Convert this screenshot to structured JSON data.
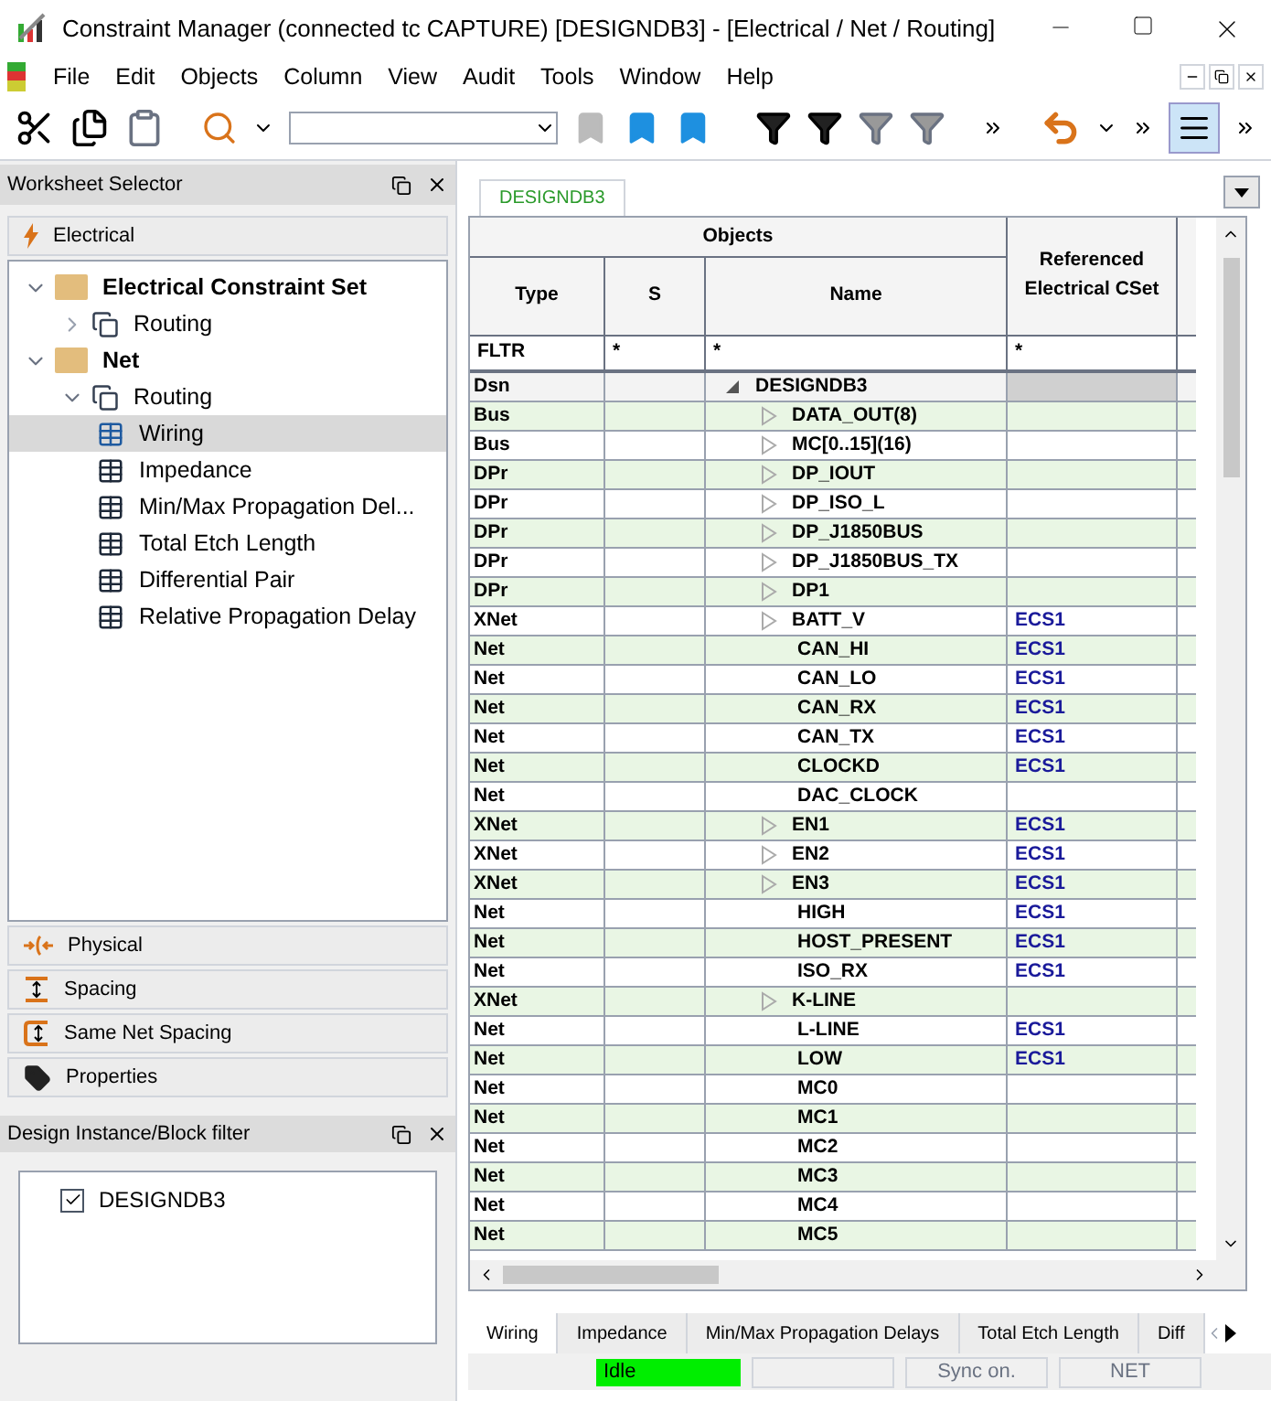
{
  "window": {
    "title": "Constraint Manager (connected tc CAPTURE) [DESIGNDB3] - [Electrical / Net / Routing]"
  },
  "menu": [
    "File",
    "Edit",
    "Objects",
    "Column",
    "View",
    "Audit",
    "Tools",
    "Window",
    "Help"
  ],
  "worksheet_selector": {
    "title": "Worksheet Selector",
    "domain": "Electrical",
    "tree": [
      {
        "label": "Electrical Constraint Set",
        "kind": "folder",
        "expanded": true,
        "children": [
          {
            "label": "Routing",
            "kind": "group",
            "expanded": false
          }
        ]
      },
      {
        "label": "Net",
        "kind": "folder",
        "expanded": true,
        "children": [
          {
            "label": "Routing",
            "kind": "group",
            "expanded": true,
            "children": [
              {
                "label": "Wiring",
                "kind": "sheet",
                "selected": true
              },
              {
                "label": "Impedance",
                "kind": "sheet",
                "selected": false
              },
              {
                "label": "Min/Max Propagation Del...",
                "kind": "sheet",
                "selected": false
              },
              {
                "label": "Total Etch Length",
                "kind": "sheet",
                "selected": false
              },
              {
                "label": "Differential Pair",
                "kind": "sheet",
                "selected": false
              },
              {
                "label": "Relative Propagation Delay",
                "kind": "sheet",
                "selected": false
              }
            ]
          }
        ]
      }
    ],
    "domains": [
      {
        "label": "Physical",
        "kind": "physical"
      },
      {
        "label": "Spacing",
        "kind": "spacing"
      },
      {
        "label": "Same Net Spacing",
        "kind": "samenet"
      },
      {
        "label": "Properties",
        "kind": "properties"
      }
    ]
  },
  "block_filter": {
    "title": "Design Instance/Block filter",
    "items": [
      {
        "label": "DESIGNDB3",
        "checked": true
      }
    ]
  },
  "design_tab": "DESIGNDB3",
  "table": {
    "group": "Objects",
    "columns": [
      "Type",
      "S",
      "Name",
      "Referenced Electrical CSet"
    ],
    "filter": [
      "FLTR",
      "*",
      "*",
      "*"
    ],
    "rows": [
      {
        "type": "Dsn",
        "name": "DESIGNDB3",
        "expanded": true,
        "children": [
          {
            "type": "Bus",
            "name": "DATA_OUT(8)",
            "expanded": false
          },
          {
            "type": "Bus",
            "name": "MC[0..15](16)",
            "expanded": false
          },
          {
            "type": "DPr",
            "name": "DP_IOUT",
            "expanded": false
          },
          {
            "type": "DPr",
            "name": "DP_ISO_L",
            "expanded": false
          },
          {
            "type": "DPr",
            "name": "DP_J1850BUS",
            "expanded": false
          },
          {
            "type": "DPr",
            "name": "DP_J1850BUS_TX",
            "expanded": false
          },
          {
            "type": "DPr",
            "name": "DP1",
            "expanded": false
          },
          {
            "type": "XNet",
            "name": "BATT_V",
            "expanded": false,
            "cset": "ECS1"
          },
          {
            "type": "Net",
            "name": "CAN_HI",
            "cset": "ECS1"
          },
          {
            "type": "Net",
            "name": "CAN_LO",
            "cset": "ECS1"
          },
          {
            "type": "Net",
            "name": "CAN_RX",
            "cset": "ECS1"
          },
          {
            "type": "Net",
            "name": "CAN_TX",
            "cset": "ECS1"
          },
          {
            "type": "Net",
            "name": "CLOCKD",
            "cset": "ECS1"
          },
          {
            "type": "Net",
            "name": "DAC_CLOCK"
          },
          {
            "type": "XNet",
            "name": "EN1",
            "expanded": false,
            "cset": "ECS1"
          },
          {
            "type": "XNet",
            "name": "EN2",
            "expanded": false,
            "cset": "ECS1"
          },
          {
            "type": "XNet",
            "name": "EN3",
            "expanded": false,
            "cset": "ECS1"
          },
          {
            "type": "Net",
            "name": "HIGH",
            "cset": "ECS1"
          },
          {
            "type": "Net",
            "name": "HOST_PRESENT",
            "cset": "ECS1"
          },
          {
            "type": "Net",
            "name": "ISO_RX",
            "cset": "ECS1"
          },
          {
            "type": "XNet",
            "name": "K-LINE",
            "expanded": false
          },
          {
            "type": "Net",
            "name": "L-LINE",
            "cset": "ECS1"
          },
          {
            "type": "Net",
            "name": "LOW",
            "cset": "ECS1"
          },
          {
            "type": "Net",
            "name": "MC0"
          },
          {
            "type": "Net",
            "name": "MC1"
          },
          {
            "type": "Net",
            "name": "MC2"
          },
          {
            "type": "Net",
            "name": "MC3"
          },
          {
            "type": "Net",
            "name": "MC4"
          },
          {
            "type": "Net",
            "name": "MC5"
          }
        ]
      }
    ]
  },
  "sheet_tabs": [
    {
      "label": "Wiring",
      "selected": true
    },
    {
      "label": "Impedance",
      "selected": false
    },
    {
      "label": "Min/Max Propagation Delays",
      "selected": false
    },
    {
      "label": "Total Etch Length",
      "selected": false
    },
    {
      "label": "Diff",
      "selected": false
    }
  ],
  "status_bar": {
    "state": "Idle",
    "sync": "Sync on.",
    "mode": "NET"
  }
}
